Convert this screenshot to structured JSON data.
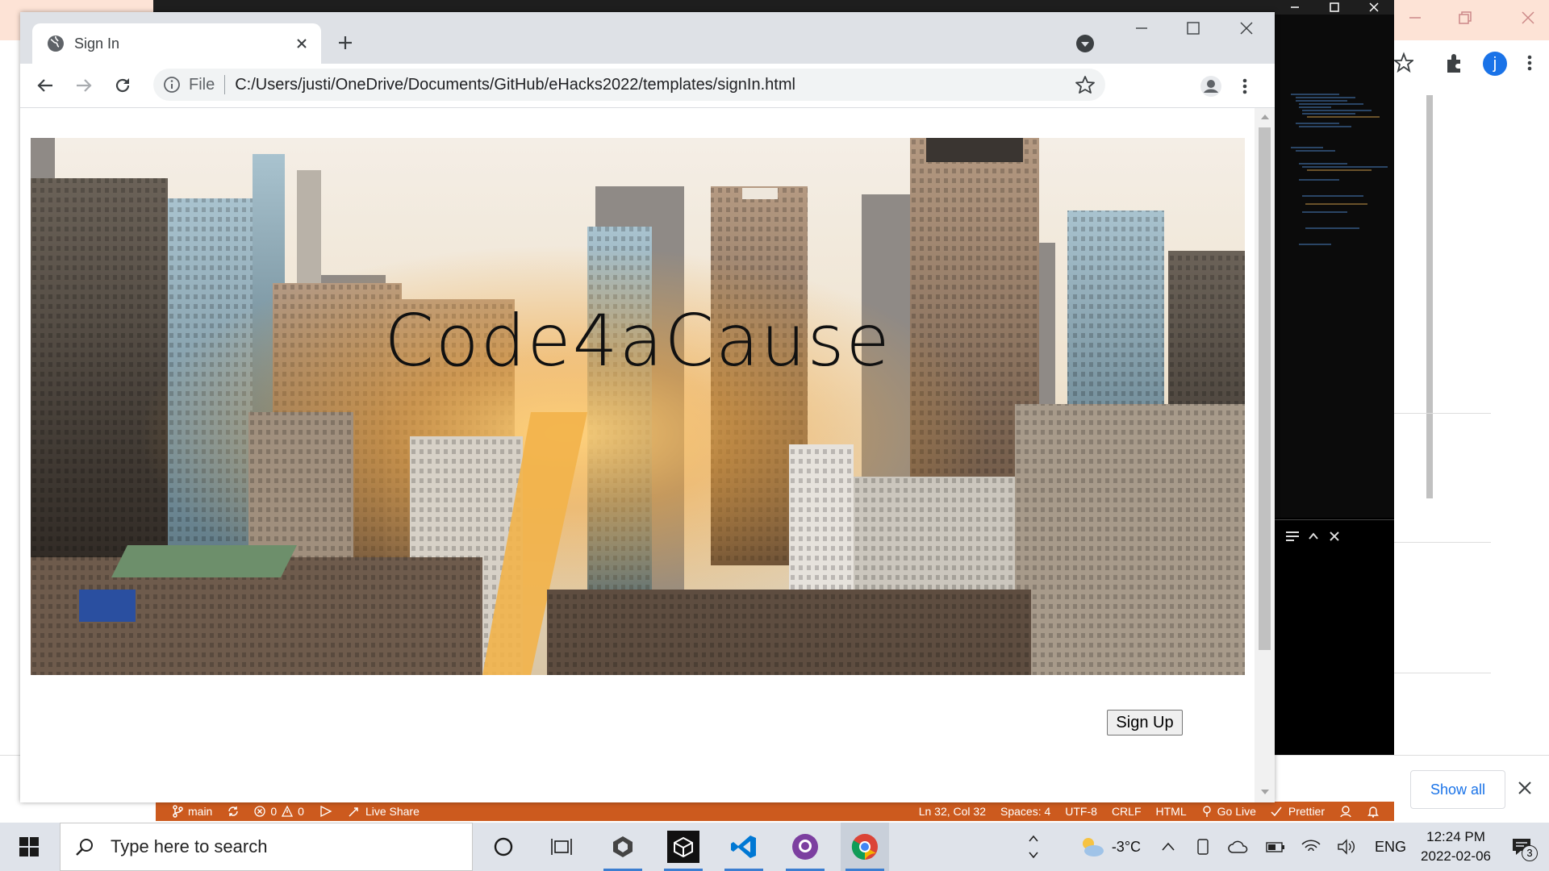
{
  "browser": {
    "tab_title": "Sign In",
    "omnibox": {
      "scheme": "File",
      "url": "C:/Users/justi/OneDrive/Documents/GitHub/eHacks2022/templates/signIn.html"
    }
  },
  "page": {
    "hero_title": "Code4aCause",
    "signup_label": "Sign Up"
  },
  "background": {
    "show_all_label": "Show all",
    "profile_initial": "j"
  },
  "vscode_status": {
    "branch": "main",
    "problems_errors": "0",
    "problems_warnings": "0",
    "live_share": "Live Share",
    "position": "Ln 32, Col 32",
    "spaces": "Spaces: 4",
    "encoding": "UTF-8",
    "eol": "CRLF",
    "language": "HTML",
    "go_live": "Go Live",
    "prettier": "Prettier"
  },
  "taskbar": {
    "search_placeholder": "Type here to search",
    "temperature": "-3°C",
    "language": "ENG",
    "time": "12:24 PM",
    "date": "2022-02-06",
    "notification_count": "3"
  },
  "colors": {
    "vscode_status_bar": "#cc5a1e",
    "chrome_tabstrip": "#dee1e6",
    "taskbar": "#dfe3ea",
    "accent": "#1a73e8"
  }
}
